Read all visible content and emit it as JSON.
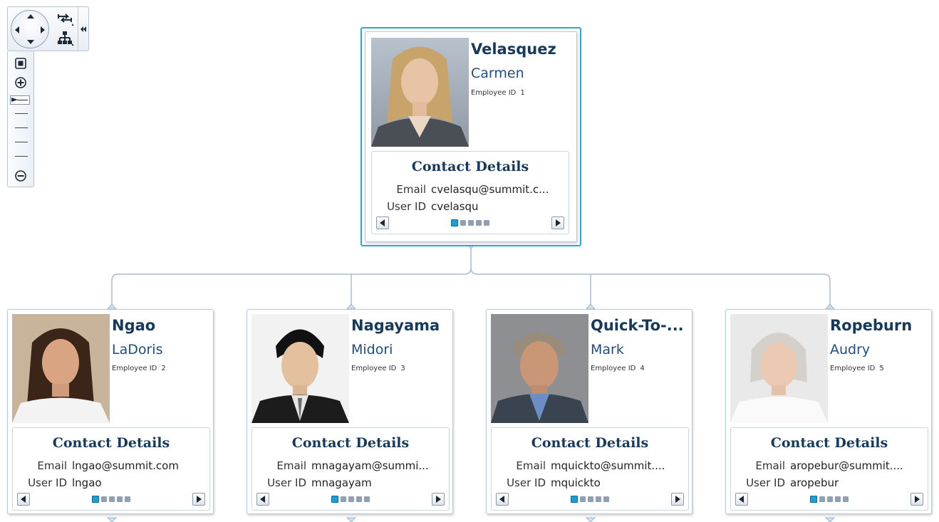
{
  "navigator": {
    "icons": [
      "pan-arrows-icon",
      "refresh-layout-icon",
      "org-chart-icon",
      "collapse-double-left-icon"
    ],
    "zoom_icons": [
      "fit-to-screen-icon",
      "zoom-in-icon",
      "zoom-out-icon"
    ],
    "zoom_level_index": 0
  },
  "colors": {
    "selected_border": "#27a8d8",
    "name_color": "#163a5c",
    "connector": "#a8bdd4",
    "active_dot": "#1aa0d8"
  },
  "root": {
    "last_name": "Velasquez",
    "first_name": "Carmen",
    "employee_id_label": "Employee ID",
    "employee_id": "1",
    "contact_title": "Contact Details",
    "email_label": "Email",
    "email": "cvelasqu@summit.c...",
    "userid_label": "User ID",
    "userid": "cvelasqu",
    "page": 1,
    "page_count": 5
  },
  "children": [
    {
      "last_name": "Ngao",
      "first_name": "LaDoris",
      "employee_id_label": "Employee ID",
      "employee_id": "2",
      "contact_title": "Contact Details",
      "email_label": "Email",
      "email": "lngao@summit.com",
      "userid_label": "User ID",
      "userid": "lngao",
      "page": 1,
      "page_count": 5
    },
    {
      "last_name": "Nagayama",
      "first_name": "Midori",
      "employee_id_label": "Employee ID",
      "employee_id": "3",
      "contact_title": "Contact Details",
      "email_label": "Email",
      "email": "mnagayam@summi...",
      "userid_label": "User ID",
      "userid": "mnagayam",
      "page": 1,
      "page_count": 5
    },
    {
      "last_name": "Quick-To-...",
      "first_name": "Mark",
      "employee_id_label": "Employee ID",
      "employee_id": "4",
      "contact_title": "Contact Details",
      "email_label": "Email",
      "email": "mquickto@summit....",
      "userid_label": "User ID",
      "userid": "mquickto",
      "page": 1,
      "page_count": 5
    },
    {
      "last_name": "Ropeburn",
      "first_name": "Audry",
      "employee_id_label": "Employee ID",
      "employee_id": "5",
      "contact_title": "Contact Details",
      "email_label": "Email",
      "email": "aropebur@summit....",
      "userid_label": "User ID",
      "userid": "aropebur",
      "page": 1,
      "page_count": 5
    }
  ]
}
